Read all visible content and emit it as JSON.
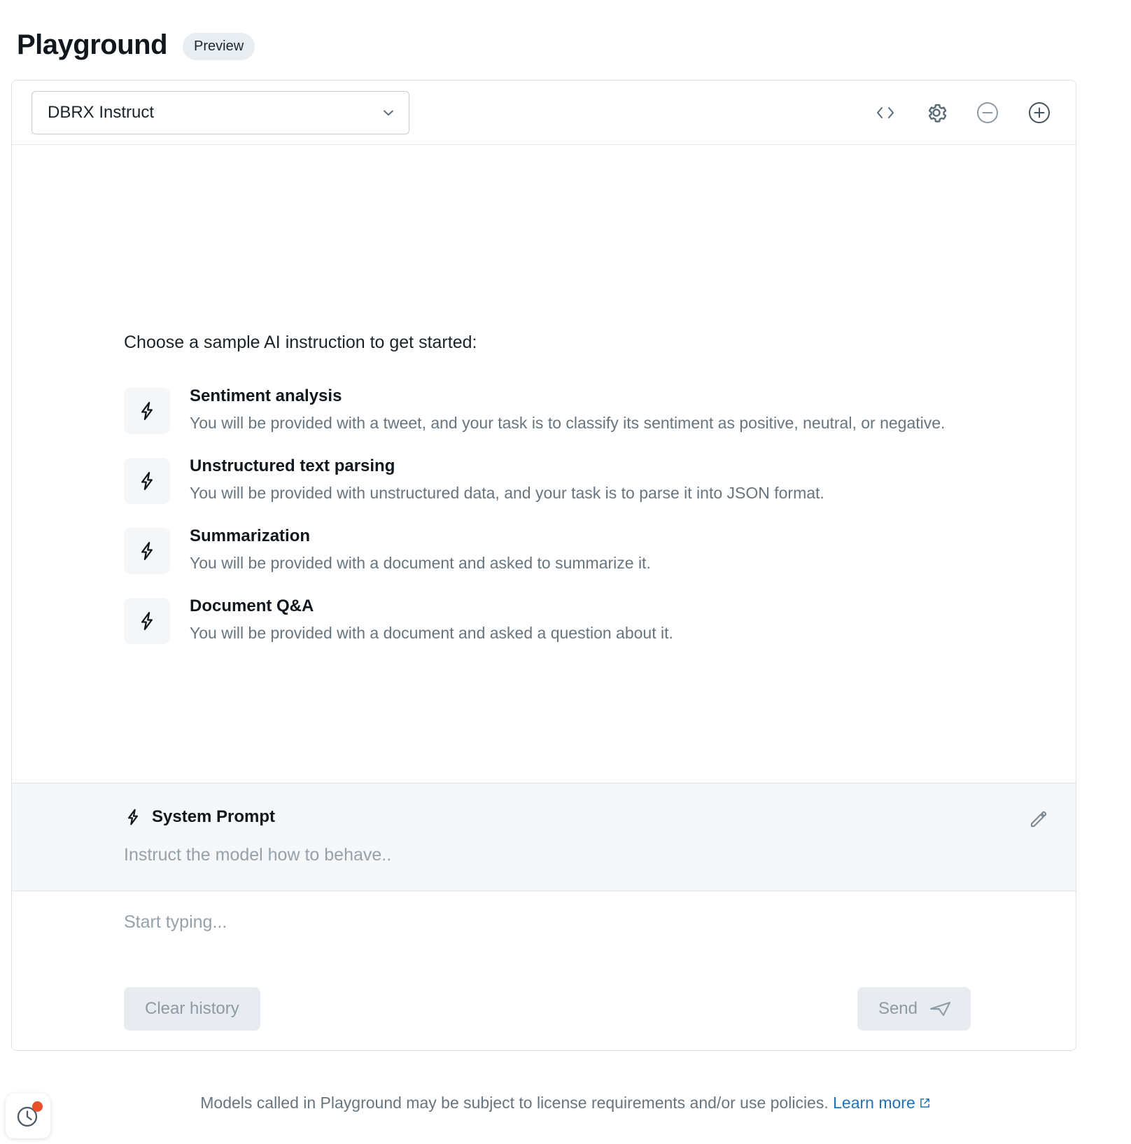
{
  "header": {
    "title": "Playground",
    "badge": "Preview"
  },
  "toolbar": {
    "model_value": "DBRX Instruct",
    "icons": [
      {
        "name": "code-icon",
        "label": "< >"
      },
      {
        "name": "gear-icon",
        "label": "Settings"
      },
      {
        "name": "minus-circle-icon",
        "label": "Remove model"
      },
      {
        "name": "plus-circle-icon",
        "label": "Add model"
      }
    ]
  },
  "samples": {
    "heading": "Choose a sample AI instruction to get started:",
    "items": [
      {
        "title": "Sentiment analysis",
        "desc": "You will be provided with a tweet, and your task is to classify its sentiment as positive, neutral, or negative."
      },
      {
        "title": "Unstructured text parsing",
        "desc": "You will be provided with unstructured data, and your task is to parse it into JSON format."
      },
      {
        "title": "Summarization",
        "desc": "You will be provided with a document and asked to summarize it."
      },
      {
        "title": "Document Q&A",
        "desc": "You will be provided with a document and asked a question about it."
      }
    ]
  },
  "system_prompt": {
    "title": "System Prompt",
    "placeholder": "Instruct the model how to behave..",
    "value": ""
  },
  "composer": {
    "placeholder": "Start typing...",
    "value": "",
    "clear_label": "Clear history",
    "send_label": "Send"
  },
  "footer": {
    "text": "Models called in Playground may be subject to license requirements and/or use policies.",
    "link_label": "Learn more"
  },
  "colors": {
    "accent_link": "#2272b4",
    "notification_dot": "#e8502a",
    "panel_border": "#dce0e5",
    "muted_text": "#68757f",
    "placeholder_text": "#96a1ab",
    "disabled_button_bg": "#e8ecf0"
  }
}
